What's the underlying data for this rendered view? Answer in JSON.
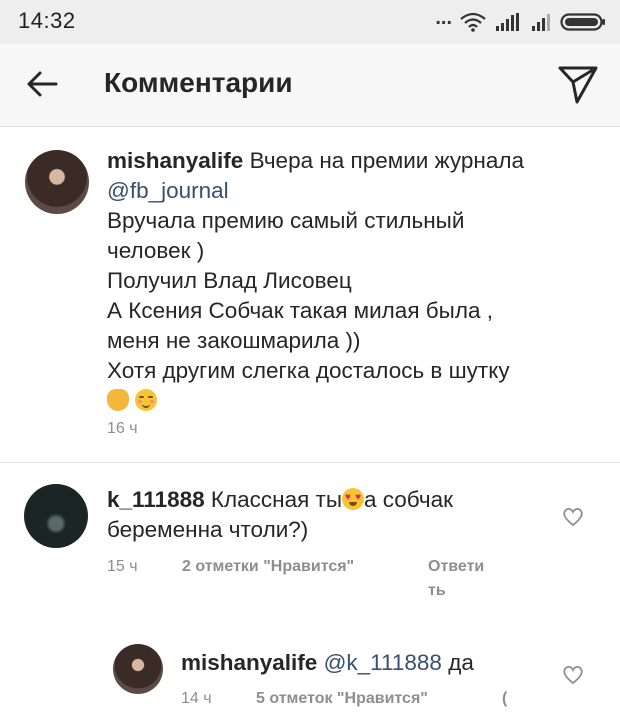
{
  "status_bar": {
    "time": "14:32",
    "dots": "...",
    "battery_icon": "battery-icon",
    "wifi_icon": "wifi-icon"
  },
  "header": {
    "title": "Комментарии",
    "back_icon": "back-arrow-icon",
    "send_icon": "send-icon"
  },
  "caption": {
    "username": "mishanyalife",
    "first_line": "Вчера на премии журнала",
    "mention": "@fb_journal",
    "lines": [
      "Вручала премию самый стильный",
      "человек )",
      "Получил Влад Лисовец",
      "А Ксения Собчак такая милая была ,",
      "меня не закошмарила ))",
      "Хотя другим слегка досталось в шутку"
    ],
    "emojis": [
      "ok-hand-emoji",
      "smiling-face-emoji"
    ],
    "time": "16 ч"
  },
  "comments": [
    {
      "username": "k_111888",
      "text_a": "Классная ты",
      "emoji": "heart-eyes-emoji",
      "text_b": "а собчак",
      "text_c": "беременна чтоли?)",
      "time": "15 ч",
      "likes": "2 отметки \"Нравится\"",
      "reply_a": "Ответи",
      "reply_b": "ть"
    }
  ],
  "replies": [
    {
      "username": "mishanyalife",
      "mention": "@k_111888",
      "text": "да",
      "time": "14 ч",
      "likes": "5 отметок \"Нравится\"",
      "reply_partial": "("
    }
  ],
  "colors": {
    "text": "#262626",
    "meta": "#8e8e8e",
    "mention": "#38506f",
    "statusbar": "#eeeeee"
  }
}
